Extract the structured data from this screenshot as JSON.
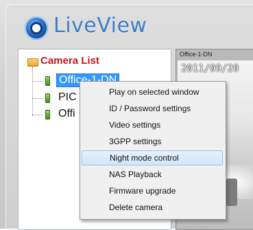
{
  "app": {
    "title": "LiveView"
  },
  "camera_list": {
    "title": "Camera List",
    "items": [
      {
        "label": "Office-1-DN",
        "selected": true
      },
      {
        "label": "PIC",
        "selected": false
      },
      {
        "label": "Offi",
        "selected": false
      }
    ]
  },
  "video": {
    "title": "Office-1-DN",
    "osd": "2011/09/20"
  },
  "context_menu": {
    "items": [
      {
        "label": "Play on selected window",
        "highlighted": false
      },
      {
        "label": "ID / Password settings",
        "highlighted": false
      },
      {
        "label": "Video settings",
        "highlighted": false
      },
      {
        "label": "3GPP settings",
        "highlighted": false
      },
      {
        "label": "Night mode control",
        "highlighted": true
      },
      {
        "label": "NAS Playback",
        "highlighted": false
      },
      {
        "label": "Firmware upgrade",
        "highlighted": false
      },
      {
        "label": "Delete camera",
        "highlighted": false
      }
    ]
  },
  "colors": {
    "accent": "#3e7dc4",
    "camera_list_title": "#c8151b",
    "selection": "#3399ff"
  }
}
